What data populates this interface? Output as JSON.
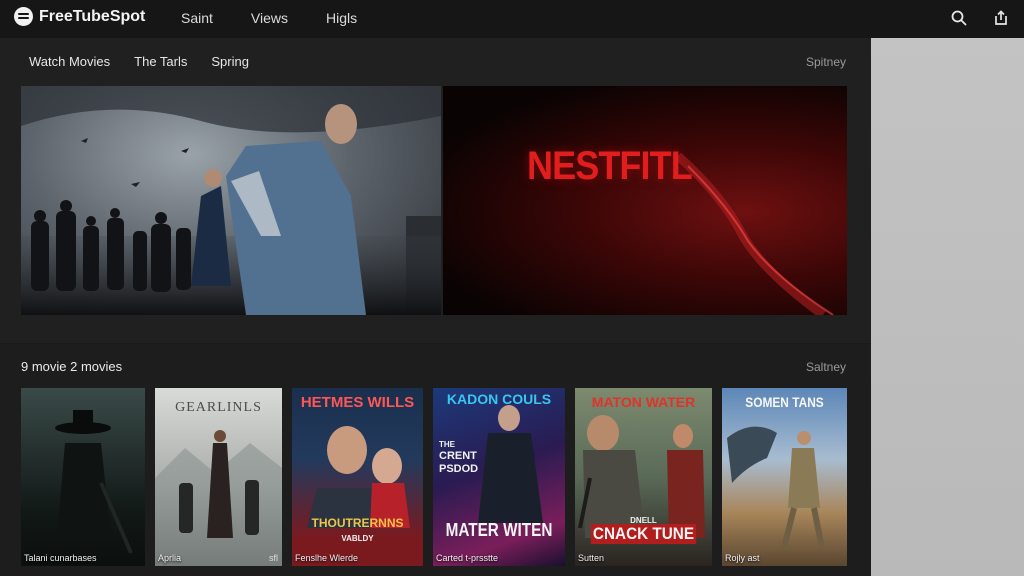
{
  "app": {
    "name": "FreeTubeSpot"
  },
  "topnav": {
    "items": [
      "Saint",
      "Views",
      "Higls"
    ]
  },
  "subnav": {
    "items": [
      "Watch Movies",
      "The Tarls",
      "Spring"
    ],
    "right_label": "Spitney"
  },
  "hero": {
    "brand_text": "NESTFITL"
  },
  "section": {
    "title": "9 movie 2 movies",
    "right_label": "Saltney"
  },
  "posters": [
    {
      "caption": "Talani cunarbases",
      "title": ""
    },
    {
      "caption": "Aprlia",
      "caption_right": "sfl",
      "title": "GEARLINLS"
    },
    {
      "caption": "Fenslhe Wlerde",
      "title": "HETMES WILLS",
      "title_bottom": "THOUTRERNNS",
      "sub_bottom": "VABLDY"
    },
    {
      "caption": "Carted t-prsstte",
      "title": "KADON COULS",
      "side_text": [
        "THE",
        "CRENT",
        "PSDOD"
      ],
      "title_bottom": "MATER WITEN"
    },
    {
      "caption": "Sutten",
      "title": "MATON WATER",
      "sub_bottom": "DNELL",
      "title_bottom": "CNACK TUNE"
    },
    {
      "caption": "Rojly ast",
      "title": "SOMEN TANS"
    }
  ],
  "colors": {
    "brand_red": "#e21d1d",
    "background": "#1a1a1a",
    "side_gray": "#bfbfbf"
  }
}
